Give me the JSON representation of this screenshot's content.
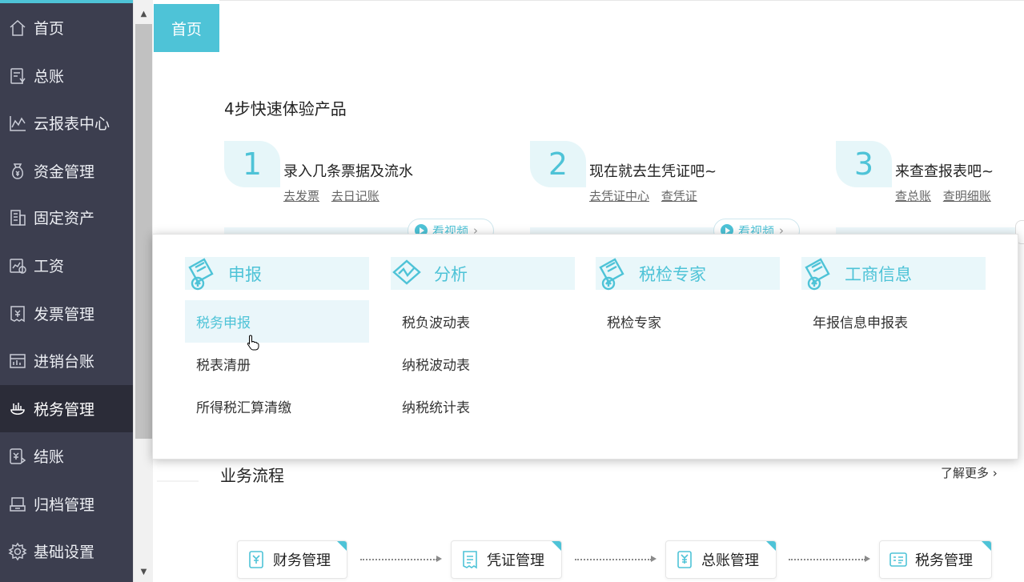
{
  "sidebar": {
    "items": [
      {
        "label": "首页",
        "icon": "home-icon",
        "active": false
      },
      {
        "label": "总账",
        "icon": "ledger-icon",
        "active": false
      },
      {
        "label": "云报表中心",
        "icon": "chart-icon",
        "active": false
      },
      {
        "label": "资金管理",
        "icon": "money-bag-icon",
        "active": false
      },
      {
        "label": "固定资产",
        "icon": "building-icon",
        "active": false
      },
      {
        "label": "工资",
        "icon": "salary-icon",
        "active": false
      },
      {
        "label": "发票管理",
        "icon": "invoice-icon",
        "active": false
      },
      {
        "label": "进销台账",
        "icon": "inventory-icon",
        "active": false
      },
      {
        "label": "税务管理",
        "icon": "tax-icon",
        "active": true
      },
      {
        "label": "结账",
        "icon": "checkout-icon",
        "active": false
      },
      {
        "label": "归档管理",
        "icon": "archive-icon",
        "active": false
      },
      {
        "label": "基础设置",
        "icon": "gear-icon",
        "active": false
      }
    ]
  },
  "tabs": {
    "home": "首页"
  },
  "quickstart": {
    "title": "4步快速体验产品",
    "steps": [
      {
        "num": "1",
        "text": "录入几条票据及流水",
        "links": [
          "去发票",
          "去日记账"
        ],
        "video": "看视频"
      },
      {
        "num": "2",
        "text": "现在就去生凭证吧~",
        "links": [
          "去凭证中心",
          "查凭证"
        ],
        "video": "看视频"
      },
      {
        "num": "3",
        "text": "来查查报表吧~",
        "links": [
          "查总账",
          "查明细账"
        ]
      }
    ]
  },
  "dropdown": {
    "columns": [
      {
        "title": "申报",
        "icon": "declare-icon",
        "items": [
          "税务申报",
          "税表清册",
          "所得税汇算清缴"
        ]
      },
      {
        "title": "分析",
        "icon": "analysis-icon",
        "items": [
          "税负波动表",
          "纳税波动表",
          "纳税统计表"
        ]
      },
      {
        "title": "税检专家",
        "icon": "tax-check-icon",
        "items": [
          "税检专家"
        ]
      },
      {
        "title": "工商信息",
        "icon": "business-info-icon",
        "items": [
          "年报信息申报表"
        ]
      }
    ],
    "hovered": "税务申报"
  },
  "flow": {
    "title": "业务流程",
    "learn_more": "了解更多",
    "boxes": [
      {
        "label": "财务管理",
        "icon": "yen-doc-icon"
      },
      {
        "label": "凭证管理",
        "icon": "voucher-icon"
      },
      {
        "label": "总账管理",
        "icon": "ledger-book-icon"
      },
      {
        "label": "税务管理",
        "icon": "tax-form-icon"
      }
    ]
  },
  "colors": {
    "accent": "#4ec3d7",
    "sidebar_bg": "#3c3e4f",
    "sidebar_active": "#2b2c38"
  }
}
